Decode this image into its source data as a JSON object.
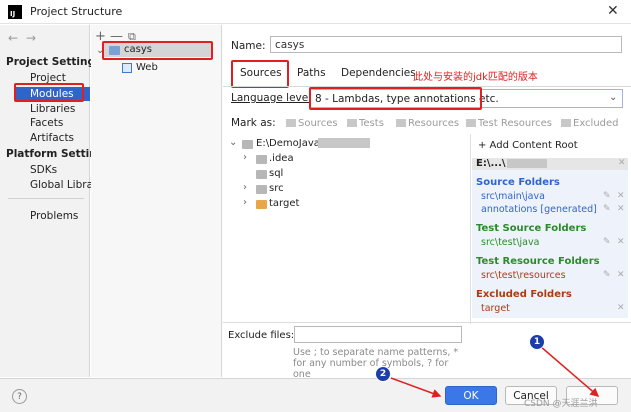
{
  "window": {
    "title": "Project Structure",
    "icon_label": "IJ"
  },
  "nav": {
    "project_settings_header": "Project Settings",
    "project_items": [
      "Project",
      "Modules",
      "Libraries",
      "Facets",
      "Artifacts"
    ],
    "platform_settings_header": "Platform Settings",
    "platform_items": [
      "SDKs",
      "Global Librar"
    ],
    "problems": "Problems",
    "selected": "Modules"
  },
  "modules": {
    "toolbar": [
      "+",
      "—",
      "⧉"
    ],
    "tree": [
      {
        "name": "casys",
        "children": [
          "Web"
        ]
      }
    ]
  },
  "form": {
    "name_label": "Name:",
    "name_value": "casys",
    "tabs": [
      "Sources",
      "Paths",
      "Dependencies"
    ],
    "active_tab": "Sources",
    "annotation": "此处与安装的jdk匹配的版本",
    "language_level_label": "Language level:",
    "language_level_value": "8 - Lambdas, type annotations etc.",
    "mark_as_label": "Mark as:",
    "mark_as_buttons": [
      "Sources",
      "Tests",
      "Resources",
      "Test Resources",
      "Excluded"
    ],
    "exclude_files_label": "Exclude files:",
    "exclude_hint": "Use ; to separate name patterns, * for any number of symbols, ? for one"
  },
  "source_tree": {
    "root": "E:\\DemoJava\\",
    "children": [
      ".idea",
      "sql",
      "src",
      "target"
    ]
  },
  "content_roots": {
    "add_label": "+ Add Content Root",
    "root_label": "E:\\...\\",
    "groups": [
      {
        "title": "Source Folders",
        "color": "#2f65ca",
        "items": [
          "src\\main\\java",
          "annotations [generated]"
        ]
      },
      {
        "title": "Test Source Folders",
        "color": "#2c8a2c",
        "items": [
          "src\\test\\java"
        ]
      },
      {
        "title": "Test Resource Folders",
        "color": "#2c8a2c",
        "items": [
          "src\\test\\resources"
        ]
      },
      {
        "title": "Excluded Folders",
        "color": "#b03a10",
        "items": [
          "target"
        ]
      }
    ]
  },
  "footer": {
    "help": "?",
    "ok": "OK",
    "cancel": "Cancel",
    "badge1": "1",
    "badge2": "2",
    "watermark": "CSDN @天涯兰洪"
  },
  "colors": {
    "selection": "#2f65ca",
    "annotation": "#e02020",
    "badge": "#1d3ea8"
  }
}
